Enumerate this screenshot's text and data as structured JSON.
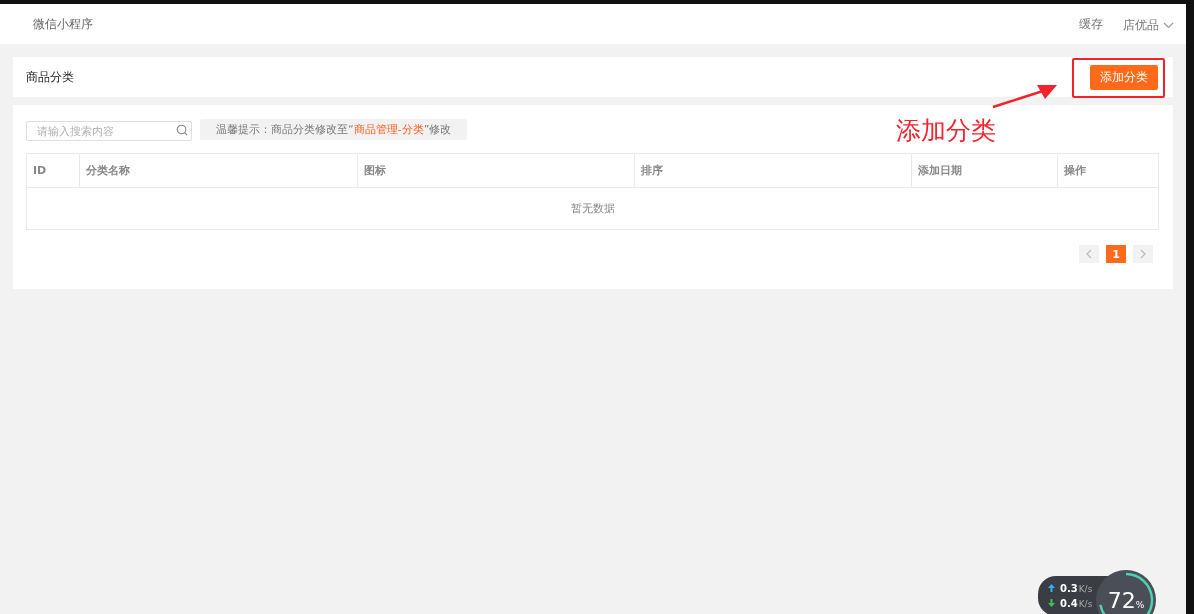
{
  "header": {
    "title": "微信小程序",
    "links": [
      {
        "label": "缓存",
        "kind": "plain"
      },
      {
        "label": "店优品",
        "kind": "dropdown"
      }
    ]
  },
  "panel": {
    "title": "商品分类",
    "add_button": "添加分类"
  },
  "search": {
    "placeholder": "请输入搜索内容"
  },
  "tip": {
    "before": "温馨提示：商品分类修改至“",
    "highlight": "商品管理-分类",
    "after": "”修改"
  },
  "table": {
    "columns": [
      "ID",
      "分类名称",
      "图标",
      "排序",
      "添加日期",
      "操作"
    ],
    "empty_text": "暂无数据"
  },
  "pagination": {
    "pages": [
      {
        "label": "1",
        "selected": true
      }
    ]
  },
  "annotation": {
    "label": "添加分类"
  },
  "net_widget": {
    "up": "0.3",
    "up_unit": "K/s",
    "down": "0.4",
    "down_unit": "K/s",
    "percent": "72",
    "percent_sign": "%"
  }
}
